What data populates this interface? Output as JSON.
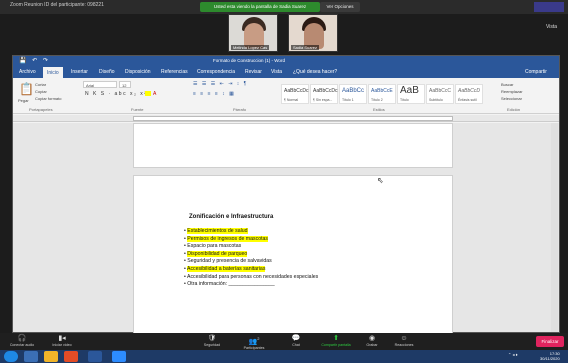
{
  "zoom": {
    "window_title": "Zoom Reunion ID del participante: 098221",
    "share_banner": "Usted esta viendo la pantalla de Sadia Suarez",
    "stop_banner": "Ver Opciones",
    "view_button": "Vista",
    "participants": [
      {
        "name": "Melinda Lopez Cas"
      },
      {
        "name": "Sadia Suarez"
      }
    ],
    "toolbar": {
      "audio": "Conectar audio",
      "video": "Iniciar video",
      "security": "Seguridad",
      "participants": "Participantes",
      "participants_count": "2",
      "chat": "Chat",
      "share": "Compartir pantalla",
      "record": "Grabar",
      "reactions": "Reacciones",
      "end": "Finalizar"
    }
  },
  "word": {
    "title": "Formato de Construccion (1) - Word",
    "tabs": [
      "Archivo",
      "Inicio",
      "Insertar",
      "Diseño",
      "Disposición",
      "Referencias",
      "Correspondencia",
      "Revisar",
      "Vista",
      "¿Qué desea hacer?"
    ],
    "share_label": "Compartir",
    "ribbon": {
      "paste_label": "Pegar",
      "cut_label": "Cortar",
      "copy_label": "Copiar",
      "format_painter_label": "Copiar formato",
      "font_name": "Arial",
      "font_size": "12",
      "groups": [
        "Portapapeles",
        "Fuente",
        "Párrafo",
        "Estilos",
        "Edición"
      ],
      "styles": [
        {
          "sample": "AaBbCcDc",
          "name": "¶ Normal"
        },
        {
          "sample": "AaBbCcDc",
          "name": "¶ Sin espa..."
        },
        {
          "sample": "AaBbCc",
          "name": "Título 1"
        },
        {
          "sample": "AaBbCcE",
          "name": "Título 2"
        },
        {
          "sample": "AaB",
          "name": "Título"
        },
        {
          "sample": "AaBbCcC",
          "name": "Subtítulo"
        },
        {
          "sample": "AaBbCcD",
          "name": "Énfasis sutil"
        }
      ],
      "find_label": "Buscar",
      "replace_label": "Reemplazar",
      "select_label": "Seleccionar"
    },
    "document": {
      "heading": "Zonificación e Infraestructura",
      "bullets": [
        {
          "text": "Establecimientos de salud",
          "highlight": true
        },
        {
          "text": "Permisos de ingresos de mascotas",
          "highlight": true
        },
        {
          "text": "Espacio para mascotas",
          "highlight": false
        },
        {
          "text": "Disponibilidad de parqueo",
          "highlight": true
        },
        {
          "text": "Seguridad y presencia de salvavidas",
          "highlight": false
        },
        {
          "text": "Accesibilidad a baterías sanitarias",
          "highlight": true
        },
        {
          "text": "Accesibilidad para personas con necesidades especiales",
          "highlight": false
        },
        {
          "text": "Otra información: ________________",
          "highlight": false
        }
      ]
    }
  },
  "taskbar": {
    "time": "17:30",
    "date": "30/11/2020"
  },
  "colors": {
    "word_blue": "#2b579a",
    "highlight": "#ffff00",
    "zoom_green": "#2d8a2d",
    "end_red": "#e0245e"
  }
}
